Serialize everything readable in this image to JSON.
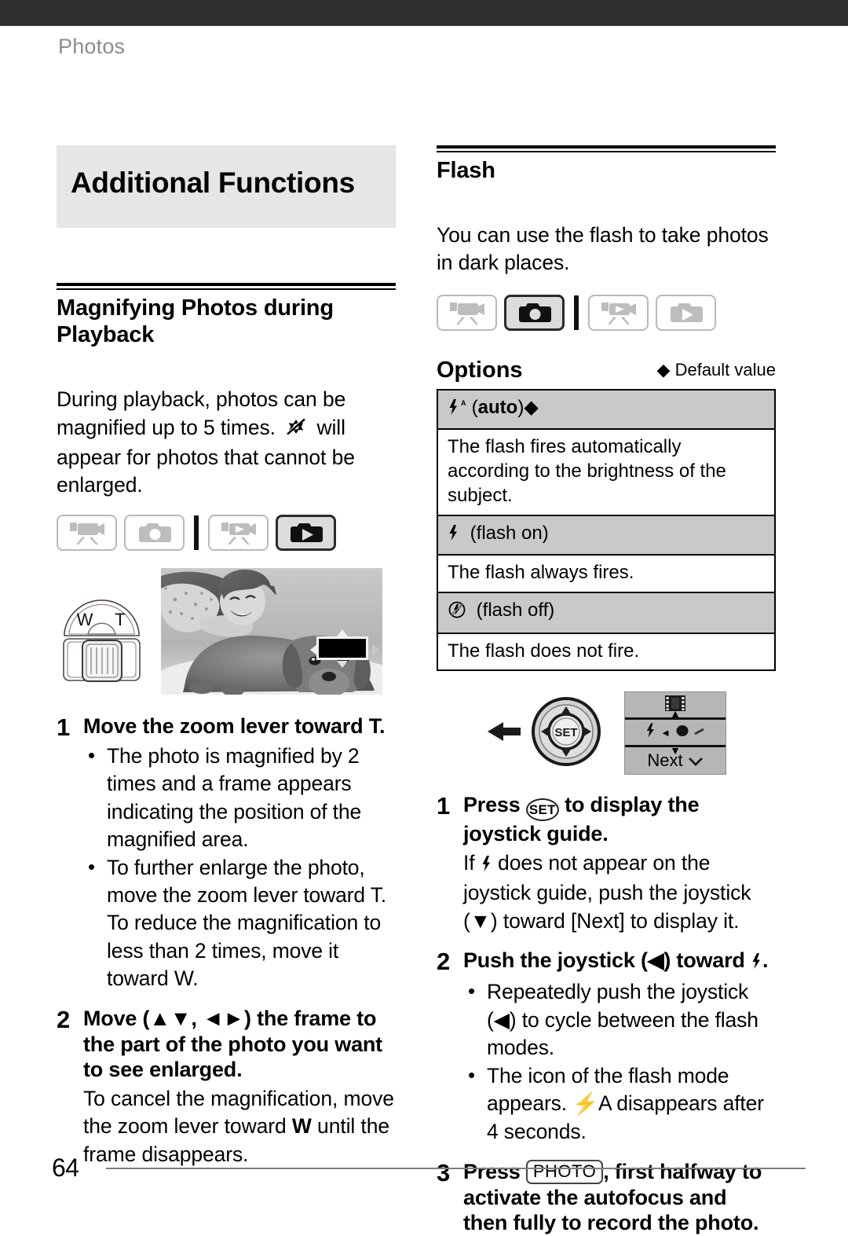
{
  "running_head": "Photos",
  "page_number": "64",
  "left_column": {
    "chapter_title": "Additional Functions",
    "section_title": "Magnifying Photos during Playback",
    "intro_part1": "During playback, photos can be magnified up to 5 times.",
    "intro_part2": "will appear for photos that cannot be enlarged.",
    "mode_icons": [
      {
        "name": "camcorder-record-mode",
        "active": false
      },
      {
        "name": "camera-record-mode",
        "active": false
      },
      {
        "name": "camcorder-playback-mode",
        "active": false
      },
      {
        "name": "camera-playback-mode",
        "active": true
      }
    ],
    "zoom_lever": {
      "wide_label": "W",
      "tele_label": "T"
    },
    "steps": [
      {
        "number": "1",
        "heading_pre": "Move the zoom lever toward ",
        "heading_key": "T",
        "heading_post": ".",
        "bullets": [
          "The photo is magnified by 2 times and a frame appears indicating the position of the magnified area.",
          "To further enlarge the photo, move the zoom lever toward T. To reduce the magnification to less than 2 times, move it toward W."
        ]
      },
      {
        "number": "2",
        "heading_pre": "Move (",
        "heading_mid": ", ",
        "heading_post": ") the frame to the part of the photo you want to see enlarged.",
        "sub_pre": "To cancel the magnification, move the zoom lever toward ",
        "sub_key": "W",
        "sub_post": " until the frame disappears."
      }
    ]
  },
  "right_column": {
    "section_title": "Flash",
    "intro": "You can use the flash to take photos in dark places.",
    "mode_icons": [
      {
        "name": "camcorder-record-mode",
        "active": false
      },
      {
        "name": "camera-record-mode",
        "active": true
      },
      {
        "name": "camcorder-playback-mode",
        "active": false
      },
      {
        "name": "camera-playback-mode",
        "active": false
      }
    ],
    "options_label": "Options",
    "default_value_note": "Default value",
    "options": [
      {
        "icon": "flash-auto-icon",
        "name": "auto",
        "name_prefix": "(",
        "name_suffix": ")",
        "has_default_marker": true,
        "description": "The flash fires automatically according to the brightness of the subject."
      },
      {
        "icon": "flash-on-icon",
        "name": "flash on",
        "name_prefix": "(",
        "name_suffix": ")",
        "has_default_marker": false,
        "description": "The flash always fires."
      },
      {
        "icon": "flash-off-icon",
        "name": "flash off",
        "name_prefix": "(",
        "name_suffix": ")",
        "has_default_marker": false,
        "description": "The flash does not fire."
      }
    ],
    "joystick_guide": {
      "set_label": "SET",
      "next_label": "Next"
    },
    "steps": [
      {
        "number": "1",
        "heading_pre": "Press ",
        "heading_key": "SET",
        "heading_post": " to display the joystick guide.",
        "sub_pre": "If ",
        "sub_post": " does not appear on the joystick guide, push the joystick (▼) toward [Next] to display it."
      },
      {
        "number": "2",
        "heading_pre": "Push the joystick (◀) toward ",
        "heading_post": ".",
        "bullets": [
          "Repeatedly push the joystick (◀) to cycle between the flash modes.",
          "The icon of the flash mode appears. ⚡A disappears after 4 seconds."
        ]
      },
      {
        "number": "3",
        "heading_pre": "Press ",
        "heading_key": "PHOTO",
        "heading_post": ", first halfway to activate the autofocus and then fully to record the photo."
      }
    ]
  },
  "colors": {
    "top_bar": "#303030",
    "chapter_band": "#e6e6e6",
    "running_head": "#8c8c8c",
    "table_header": "#c9c9c9",
    "guide_panel": "#b6b6b6"
  }
}
